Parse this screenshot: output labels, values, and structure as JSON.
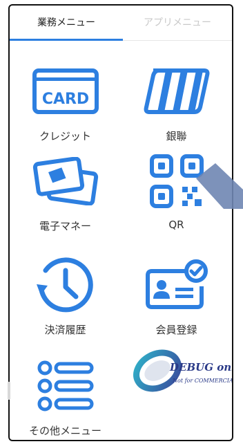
{
  "tabs": {
    "active": "業務メニュー",
    "inactive": "アプリメニュー"
  },
  "menu": {
    "credit": {
      "label": "クレジット",
      "icon_text": "CARD",
      "icon": "card-icon"
    },
    "unionpay": {
      "label": "銀聯",
      "icon": "unionpay-icon"
    },
    "emoney": {
      "label": "電子マネー",
      "icon": "emoney-cards-icon"
    },
    "qr": {
      "label": "QR",
      "icon": "qr-code-icon"
    },
    "history": {
      "label": "決済履歴",
      "icon": "history-clock-icon"
    },
    "member": {
      "label": "会員登録",
      "icon": "member-card-check-icon"
    },
    "other": {
      "label": "その他メニュー",
      "icon": "list-icon"
    }
  },
  "debug_badge": {
    "text": "DEBUG only",
    "subtext": "Not for COMMERCIAL"
  },
  "colors": {
    "accent": "#2d7fe0",
    "pointer": "#6f86b3"
  }
}
